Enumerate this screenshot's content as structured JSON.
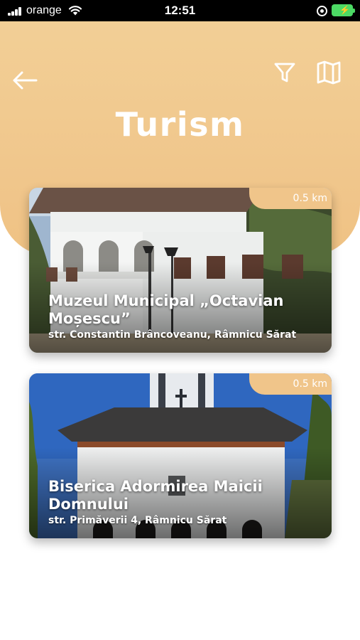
{
  "status_bar": {
    "carrier": "orange",
    "time": "12:51"
  },
  "header": {
    "title": "Turism"
  },
  "places": [
    {
      "name": "Muzeul Municipal „Octavian Moșescu”",
      "address": "str. Constantin Brâncoveanu, Râmnicu Sărat",
      "distance": "0.5 km"
    },
    {
      "name": "Biserica Adormirea Maicii Domnului",
      "address": "str. Primăverii 4, Râmnicu Sărat",
      "distance": "0.5 km"
    }
  ],
  "colors": {
    "accent": "#f0c58a",
    "status_bar": "#000000",
    "battery": "#4cd964"
  }
}
